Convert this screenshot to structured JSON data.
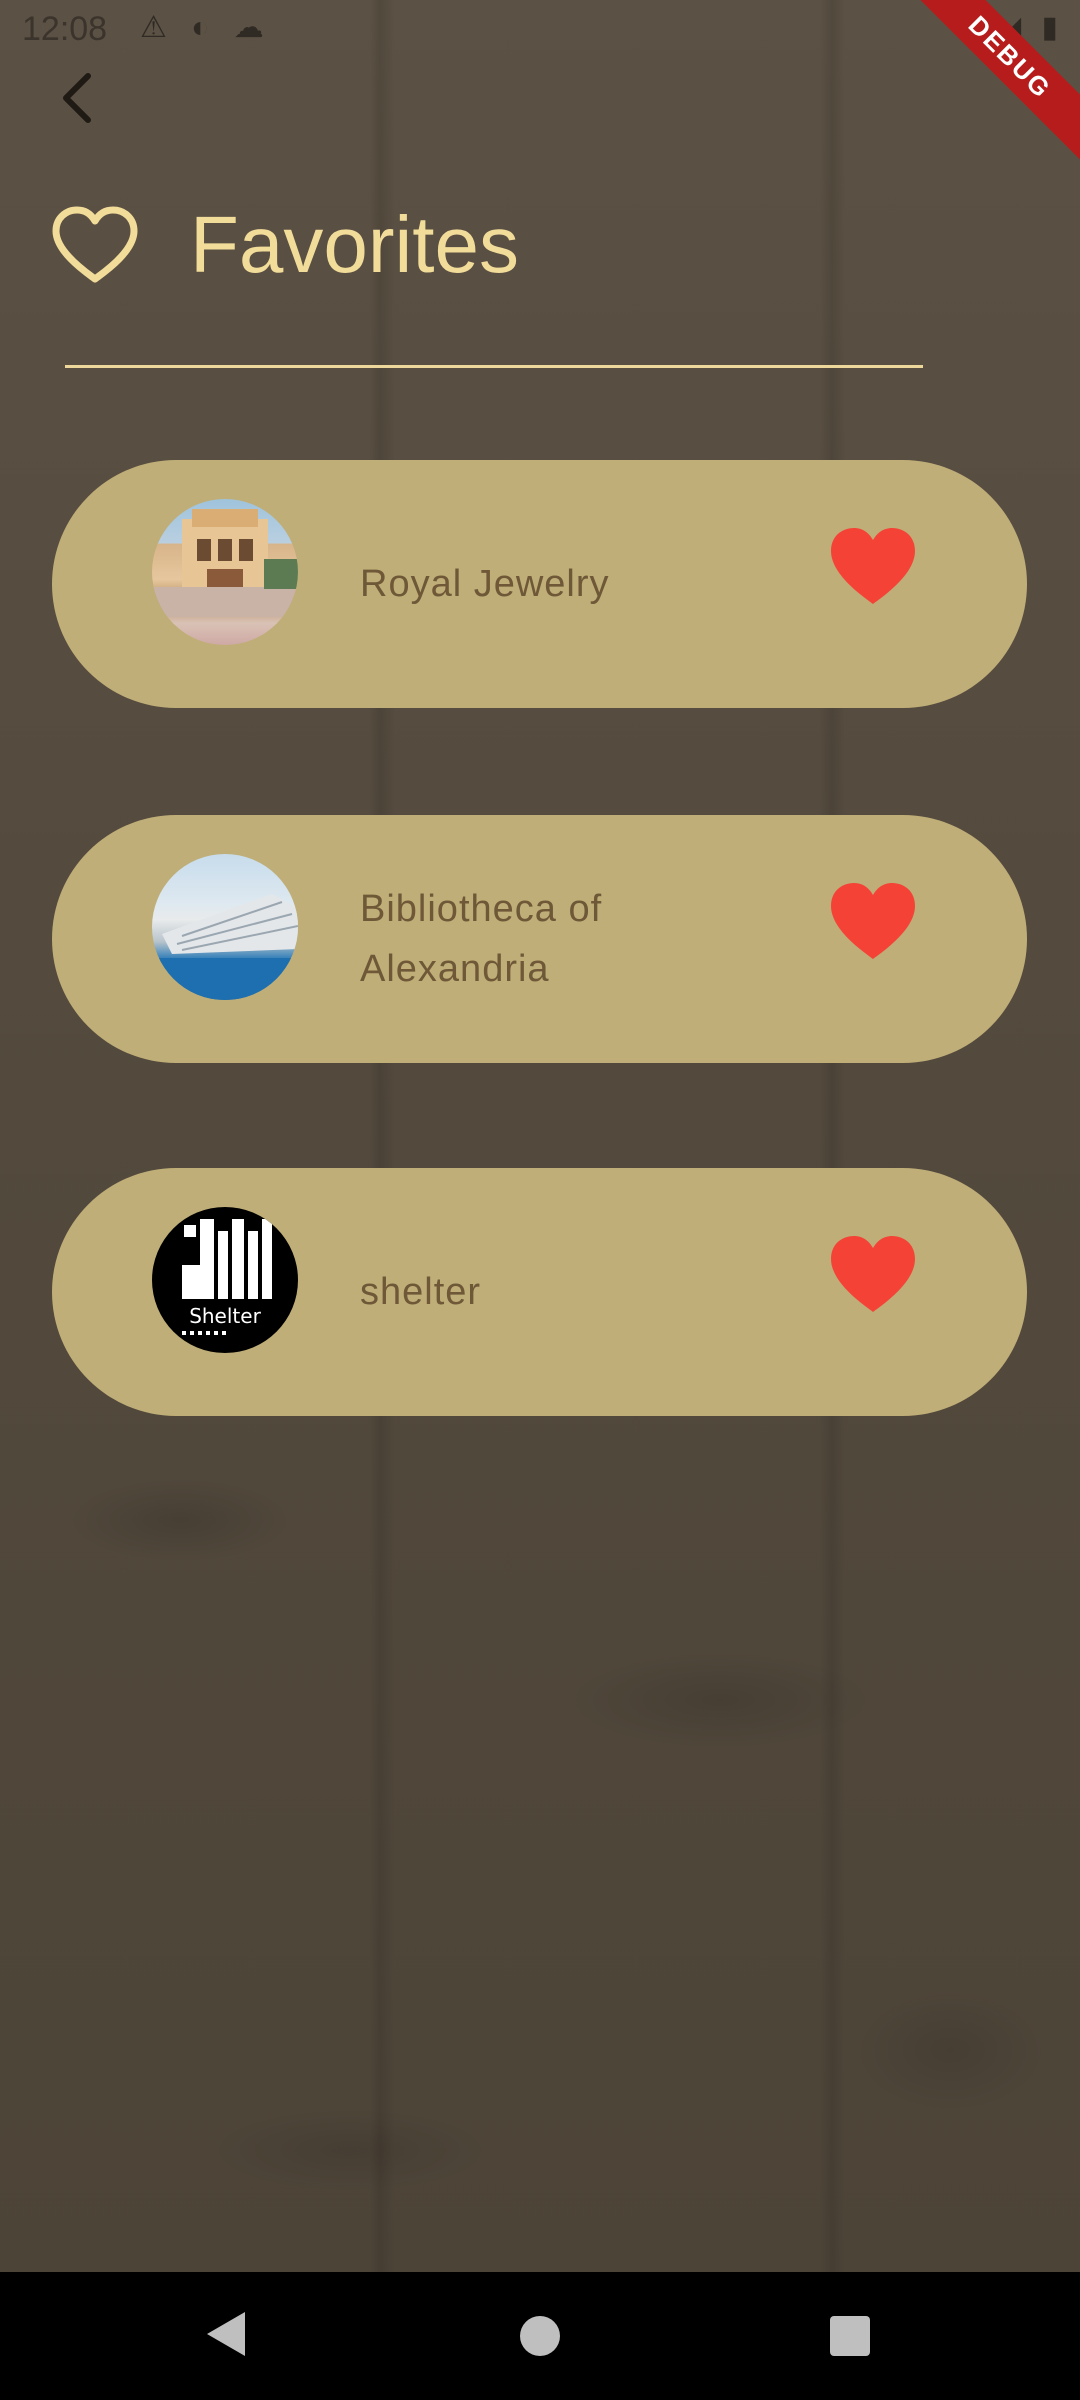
{
  "status_bar": {
    "time": "12:08",
    "left_icons": [
      "warning-icon",
      "vpn-icon",
      "cloud-icon"
    ],
    "right_icons": [
      "wifi-icon",
      "signal-icon",
      "battery-icon"
    ]
  },
  "debug_banner": "DEBUG",
  "header": {
    "title": "Favorites"
  },
  "favorites": [
    {
      "name": "Royal Jewelry",
      "image": "royal-jewelry-palace-image"
    },
    {
      "name": "Bibliotheca of Alexandria",
      "image": "bibliotheca-image"
    },
    {
      "name": "shelter",
      "image": "shelter-logo-image",
      "logo_text": "Shelter"
    }
  ],
  "colors": {
    "accent": "#f2dc9a",
    "card": "#bfae77",
    "card_text": "#6e5838",
    "favorite_heart": "#f44336"
  }
}
